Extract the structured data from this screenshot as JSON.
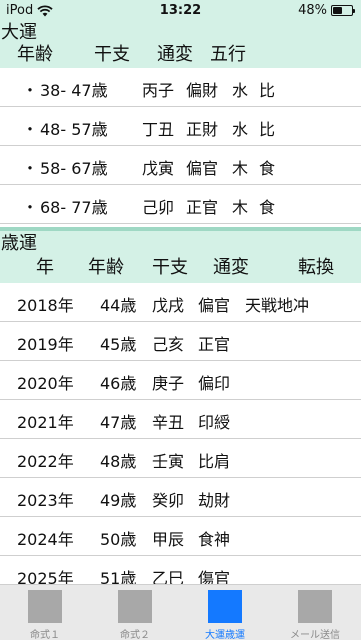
{
  "status": {
    "device": "iPod",
    "time": "13:22",
    "battery": "48%",
    "battery_level": 0.48
  },
  "taiun": {
    "title": "大運",
    "headers": {
      "age": "年齢",
      "kanshi": "干支",
      "tsuhen": "通変",
      "gogyo": "五行"
    },
    "rows": [
      {
        "bullet": "・",
        "age": "38- 47歳",
        "kanshi": "丙子",
        "tsuhen": "偏財",
        "gogyo": "水",
        "extra": "比"
      },
      {
        "bullet": "・",
        "age": "48- 57歳",
        "kanshi": "丁丑",
        "tsuhen": "正財",
        "gogyo": "水",
        "extra": "比"
      },
      {
        "bullet": "・",
        "age": "58- 67歳",
        "kanshi": "戊寅",
        "tsuhen": "偏官",
        "gogyo": "木",
        "extra": "食"
      },
      {
        "bullet": "・",
        "age": "68- 77歳",
        "kanshi": "己卯",
        "tsuhen": "正官",
        "gogyo": "木",
        "extra": "食"
      }
    ]
  },
  "saiun": {
    "title": "歳運",
    "headers": {
      "year": "年",
      "age": "年齢",
      "kanshi": "干支",
      "tsuhen": "通変",
      "tenkan": "転換"
    },
    "rows": [
      {
        "year": "2018年",
        "age": "44歳",
        "kanshi": "戊戌",
        "tsuhen": "偏官",
        "tenkan": "天戦地冲"
      },
      {
        "year": "2019年",
        "age": "45歳",
        "kanshi": "己亥",
        "tsuhen": "正官",
        "tenkan": ""
      },
      {
        "year": "2020年",
        "age": "46歳",
        "kanshi": "庚子",
        "tsuhen": "偏印",
        "tenkan": ""
      },
      {
        "year": "2021年",
        "age": "47歳",
        "kanshi": "辛丑",
        "tsuhen": "印綬",
        "tenkan": ""
      },
      {
        "year": "2022年",
        "age": "48歳",
        "kanshi": "壬寅",
        "tsuhen": "比肩",
        "tenkan": ""
      },
      {
        "year": "2023年",
        "age": "49歳",
        "kanshi": "癸卯",
        "tsuhen": "劫財",
        "tenkan": ""
      },
      {
        "year": "2024年",
        "age": "50歳",
        "kanshi": "甲辰",
        "tsuhen": "食神",
        "tenkan": ""
      },
      {
        "year": "2025年",
        "age": "51歳",
        "kanshi": "乙巳",
        "tsuhen": "傷官",
        "tenkan": ""
      }
    ]
  },
  "tabs": [
    {
      "label": "命式１",
      "active": false
    },
    {
      "label": "命式２",
      "active": false
    },
    {
      "label": "大運歳運",
      "active": true
    },
    {
      "label": "メール送信",
      "active": false
    }
  ],
  "colors": {
    "header_bg": "#d4f1e6",
    "divider": "#9fd8c4",
    "tab_active": "#1479ff",
    "tab_inactive": "#a8a8a8"
  }
}
